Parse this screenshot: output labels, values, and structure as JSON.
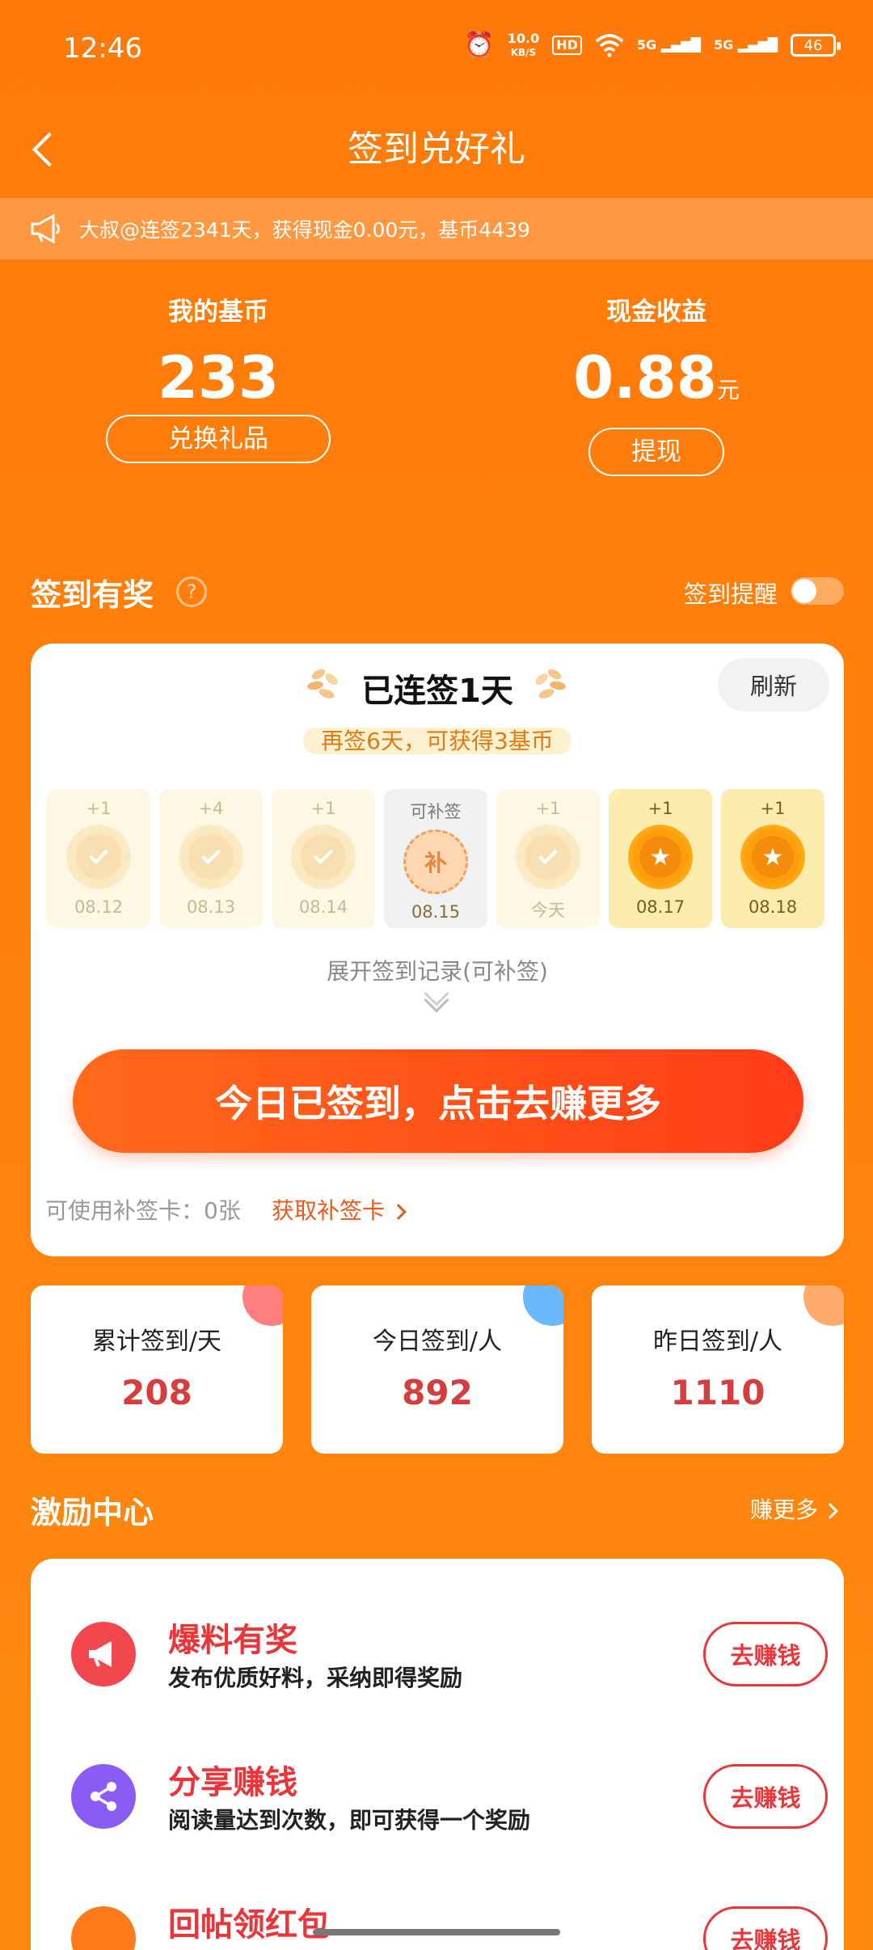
{
  "status_bar": {
    "time": "12:46",
    "network_speed": "10.0",
    "network_speed_unit": "KB/S",
    "hd_badge": "HD",
    "signal_1": "5G",
    "signal_2": "5G",
    "battery": "46"
  },
  "nav": {
    "title": "签到兑好礼"
  },
  "notice": {
    "text": "大叔@连签2341天，获得现金0.00元，基币4439"
  },
  "stats": {
    "coins_label": "我的基币",
    "coins_value": "233",
    "coins_button": "兑换礼品",
    "cash_label": "现金收益",
    "cash_value": "0.88",
    "cash_unit": "元",
    "cash_button": "提现"
  },
  "checkin_section": {
    "title": "签到有奖",
    "help": "?",
    "reminder_label": "签到提醒",
    "reminder_on": false
  },
  "checkin_card": {
    "streak_title": "已连签1天",
    "refresh": "刷新",
    "subtitle": "再签6天，可获得3基币",
    "days": [
      {
        "bonus": "+1",
        "date": "08.12",
        "state": "done"
      },
      {
        "bonus": "+4",
        "date": "08.13",
        "state": "done"
      },
      {
        "bonus": "+1",
        "date": "08.14",
        "state": "done"
      },
      {
        "bonus": "可补签",
        "date": "08.15",
        "state": "makeup",
        "coin_text": "补"
      },
      {
        "bonus": "+1",
        "date": "今天",
        "state": "done"
      },
      {
        "bonus": "+1",
        "date": "08.17",
        "state": "future"
      },
      {
        "bonus": "+1",
        "date": "08.18",
        "state": "future"
      }
    ],
    "expand_link": "展开签到记录(可补签)",
    "main_button": "今日已签到，点击去赚更多",
    "makeup_card_text": "可使用补签卡：0张",
    "makeup_card_link": "获取补签卡"
  },
  "summary": [
    {
      "label": "累计签到/天",
      "value": "208",
      "corner_color": "#ff7f7f"
    },
    {
      "label": "今日签到/人",
      "value": "892",
      "corner_color": "#6cb8ff"
    },
    {
      "label": "昨日签到/人",
      "value": "1110",
      "corner_color": "#ffab6e"
    }
  ],
  "incentive": {
    "title": "激励中心",
    "more": "赚更多",
    "tasks": [
      {
        "title": "爆料有奖",
        "desc": "发布优质好料，采纳即得奖励",
        "button": "去赚钱",
        "icon": "megaphone-icon",
        "icon_color": "#f2474f"
      },
      {
        "title": "分享赚钱",
        "desc": "阅读量达到次数，即可获得一个奖励",
        "button": "去赚钱",
        "icon": "share-icon",
        "icon_color": "#8a5cf5"
      },
      {
        "title": "回帖领红包",
        "desc": "",
        "button": "去赚钱",
        "icon": "reply-icon",
        "icon_color": "#ff7a1a"
      }
    ]
  }
}
